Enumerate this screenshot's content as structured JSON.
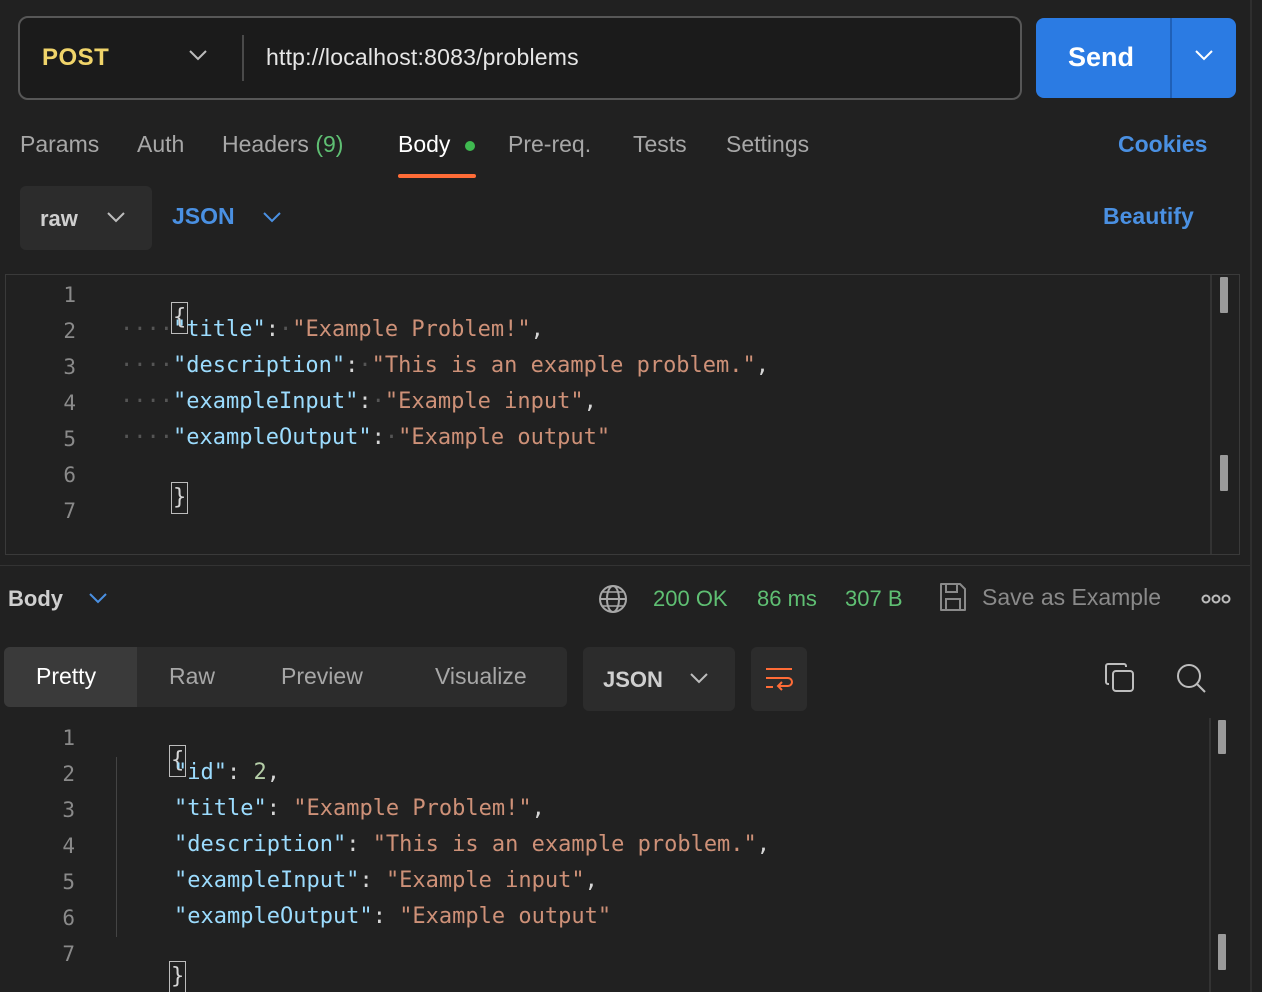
{
  "request": {
    "method": "POST",
    "url": "http://localhost:8083/problems",
    "send_label": "Send"
  },
  "tabs": {
    "params": "Params",
    "auth": "Auth",
    "headers": "Headers",
    "headers_count": "(9)",
    "body": "Body",
    "prereq": "Pre-req.",
    "tests": "Tests",
    "settings": "Settings",
    "cookies": "Cookies"
  },
  "body_mode": {
    "mode": "raw",
    "language": "JSON",
    "beautify": "Beautify"
  },
  "request_body": {
    "line_numbers": [
      "1",
      "2",
      "3",
      "4",
      "5",
      "6",
      "7"
    ],
    "open_brace": "{",
    "close_brace": "}",
    "lines": [
      {
        "key": "\"title\"",
        "value": "\"Example Problem!\"",
        "trail": ","
      },
      {
        "key": "\"description\"",
        "value": "\"This is an example problem.\"",
        "trail": ","
      },
      {
        "key": "\"exampleInput\"",
        "value": "\"Example input\"",
        "trail": ","
      },
      {
        "key": "\"exampleOutput\"",
        "value": "\"Example output\"",
        "trail": ""
      }
    ]
  },
  "response": {
    "body_label": "Body",
    "status": "200 OK",
    "time": "86 ms",
    "size": "307 B",
    "save_as_example": "Save as Example",
    "view_tabs": [
      "Pretty",
      "Raw",
      "Preview",
      "Visualize"
    ],
    "format": "JSON",
    "line_numbers": [
      "1",
      "2",
      "3",
      "4",
      "5",
      "6",
      "7"
    ],
    "open_brace": "{",
    "close_brace": "}",
    "lines": [
      {
        "key": "\"id\"",
        "value": "2",
        "value_type": "number",
        "trail": ","
      },
      {
        "key": "\"title\"",
        "value": "\"Example Problem!\"",
        "value_type": "string",
        "trail": ","
      },
      {
        "key": "\"description\"",
        "value": "\"This is an example problem.\"",
        "value_type": "string",
        "trail": ","
      },
      {
        "key": "\"exampleInput\"",
        "value": "\"Example input\"",
        "value_type": "string",
        "trail": ","
      },
      {
        "key": "\"exampleOutput\"",
        "value": "\"Example output\"",
        "value_type": "string",
        "trail": ""
      }
    ]
  },
  "colors": {
    "method": "#f0d46a",
    "send": "#2b7be3",
    "link": "#4a90e2",
    "status_ok": "#5fbf73",
    "json_key": "#9cdcfe",
    "json_string": "#ce9178",
    "json_number": "#b5cea8",
    "active_tab_underline": "#ff6c37"
  },
  "icons": [
    "chevron-down-icon",
    "globe-icon",
    "save-icon",
    "more-icon",
    "wrap-lines-icon",
    "copy-icon",
    "search-icon"
  ]
}
